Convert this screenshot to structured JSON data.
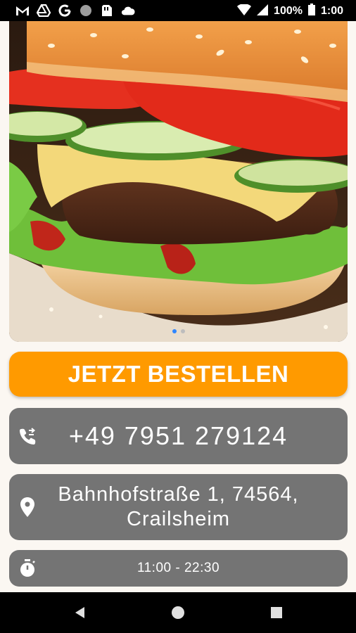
{
  "status_bar": {
    "icons": [
      "gmail-icon",
      "drive-icon",
      "google-icon",
      "circle-icon",
      "clipboard-icon",
      "cloud-icon"
    ],
    "battery": "100%",
    "time": "1:00"
  },
  "carousel": {
    "image": "burger-photo",
    "page_count": 2,
    "active_index": 0
  },
  "order_button": {
    "label": "JETZT BESTELLEN"
  },
  "phone": {
    "number": "+49 7951 279124",
    "icon": "phone-forward-icon"
  },
  "address": {
    "line1": "Bahnhofstraße 1, 74564,",
    "line2": "Crailsheim",
    "icon": "location-pin-icon"
  },
  "hours": {
    "text": "11:00 - 22:30",
    "icon": "stopwatch-icon"
  },
  "nav_bar": {
    "buttons": [
      "back-button",
      "home-button",
      "recents-button"
    ]
  },
  "colors": {
    "accent": "#ff9a00",
    "card": "#747474",
    "background": "#fbf7f2",
    "carousel_active_dot": "#2f86ff"
  }
}
